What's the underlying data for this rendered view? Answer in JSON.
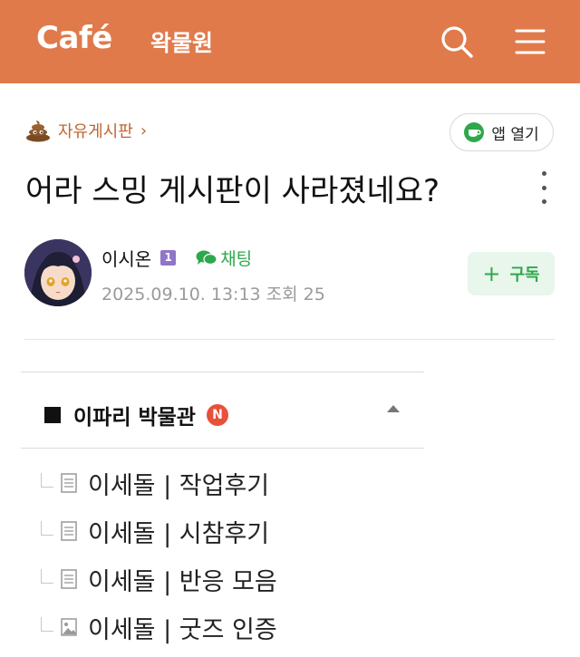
{
  "header": {
    "logo": "Café",
    "cafe_name": "왁물원",
    "background_color": "#e07a4b",
    "search_icon": "search-icon",
    "menu_icon": "hamburger-menu-icon"
  },
  "board": {
    "name": "자유게시판",
    "chevron": "›",
    "emoji_icon": "poop-emoji-icon"
  },
  "app_button": {
    "label": "앱 열기",
    "icon": "coffee-cup-icon"
  },
  "post": {
    "title": "어라 스밍 게시판이 사라졌네요?",
    "author": "이시온",
    "rank_badge": "1",
    "chat_label": "채팅",
    "date": "2025.09.10. 13:13",
    "views": "조회 25",
    "subscribe_label": "구독",
    "subscribe_plus": "+"
  },
  "related": {
    "title": "이파리 박물관",
    "new_badge": "N",
    "items": [
      {
        "label": "이세돌 | 작업후기",
        "icon": "document-icon"
      },
      {
        "label": "이세돌 | 시참후기",
        "icon": "document-icon"
      },
      {
        "label": "이세돌 | 반응 모음",
        "icon": "document-icon"
      },
      {
        "label": "이세돌 | 굿즈 인증",
        "icon": "image-icon"
      }
    ]
  },
  "colors": {
    "accent_green": "#2ea84c",
    "board_link": "#c0652e",
    "new_badge": "#e8503a",
    "rank_badge": "#8e76c8"
  }
}
